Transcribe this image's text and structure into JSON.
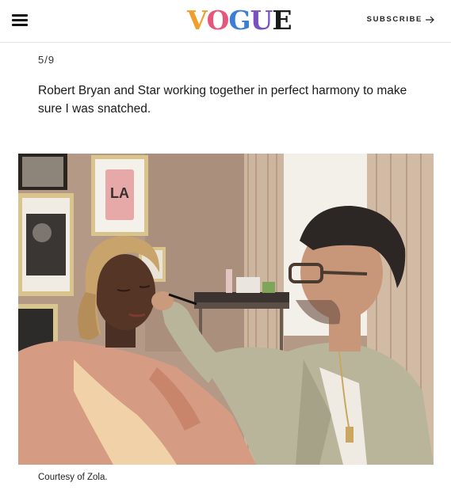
{
  "header": {
    "logo_letters": [
      "V",
      "O",
      "G",
      "U",
      "E"
    ],
    "subscribe_label": "SUBSCRIBE",
    "colors": {
      "v": "#f0a02a",
      "o": "#e8557a",
      "g": "#3a7fd4",
      "u": "#7a4fc2",
      "e": "#1b1b1b"
    }
  },
  "slide": {
    "counter": "5/9",
    "caption": "Robert Bryan and Star working together in perfect harmony to make sure I was snatched.",
    "credit": "Courtesy of Zola."
  },
  "photo": {
    "sign_text": "LA",
    "icon": "photo-makeup-scene"
  }
}
